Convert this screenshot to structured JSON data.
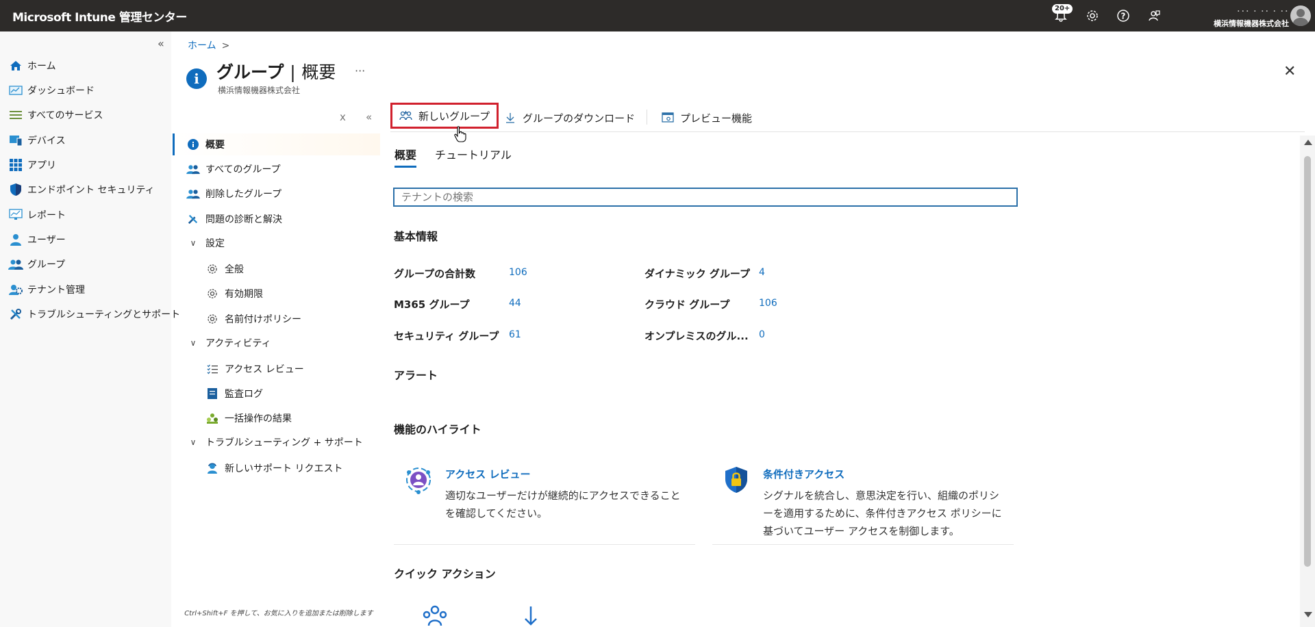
{
  "topbar": {
    "title": "Microsoft Intune 管理センター",
    "notifications_badge": "20+",
    "tenant_top": "･･･ ･ ･･ ･ ･･",
    "tenant_name": "横浜情報機器株式会社"
  },
  "leftnav": {
    "collapse": "«",
    "items": [
      {
        "label": "ホーム",
        "icon": "home-icon"
      },
      {
        "label": "ダッシュボード",
        "icon": "dashboard-icon"
      },
      {
        "label": "すべてのサービス",
        "icon": "list-icon"
      },
      {
        "label": "デバイス",
        "icon": "devices-icon"
      },
      {
        "label": "アプリ",
        "icon": "apps-icon"
      },
      {
        "label": "エンドポイント セキュリティ",
        "icon": "shield-icon"
      },
      {
        "label": "レポート",
        "icon": "report-icon"
      },
      {
        "label": "ユーザー",
        "icon": "user-icon"
      },
      {
        "label": "グループ",
        "icon": "group-icon"
      },
      {
        "label": "テナント管理",
        "icon": "tenant-icon"
      },
      {
        "label": "トラブルシューティングとサポート",
        "icon": "tools-icon"
      }
    ]
  },
  "breadcrumb": {
    "home": "ホーム",
    "sep": ">"
  },
  "page": {
    "title": "グループ",
    "title_sep": "|",
    "title_section": "概要",
    "subtitle": "横浜情報機器株式会社",
    "more": "···",
    "close": "✕"
  },
  "subnav": {
    "close": "x",
    "collapse": "«",
    "items": {
      "overview": "概要",
      "all_groups": "すべてのグループ",
      "deleted_groups": "削除したグループ",
      "diagnose": "問題の診断と解決",
      "settings": "設定",
      "general": "全般",
      "expiration": "有効期限",
      "naming_policy": "名前付けポリシー",
      "activity": "アクティビティ",
      "access_reviews": "アクセス レビュー",
      "audit_logs": "監査ログ",
      "bulk_results": "一括操作の結果",
      "troubleshooting": "トラブルシューティング + サポート",
      "new_support_request": "新しいサポート リクエスト"
    },
    "hint": "Ctrl+Shift+F を押して、お気に入りを追加または削除します"
  },
  "cmdbar": {
    "new_group": "新しいグループ",
    "download_groups": "グループのダウンロード",
    "preview_features": "プレビュー機能"
  },
  "tabs": {
    "overview": "概要",
    "tutorial": "チュートリアル"
  },
  "search": {
    "placeholder": "テナントの検索"
  },
  "basic": {
    "heading": "基本情報",
    "total_label": "グループの合計数",
    "total_value": "106",
    "m365_label": "M365 グループ",
    "m365_value": "44",
    "security_label": "セキュリティ グループ",
    "security_value": "61",
    "dynamic_label": "ダイナミック グループ",
    "dynamic_value": "4",
    "cloud_label": "クラウド グループ",
    "cloud_value": "106",
    "onprem_label": "オンプレミスのグル...",
    "onprem_value": "0"
  },
  "alerts": {
    "heading": "アラート"
  },
  "highlights": {
    "heading": "機能のハイライト",
    "access_review_title": "アクセス レビュー",
    "access_review_line1": "適切なユーザーだけが継続的にアクセスできること",
    "access_review_line2": "を確認してください。",
    "conditional_title": "条件付きアクセス",
    "conditional_line1": "シグナルを統合し、意思決定を行い、組織のポリシ",
    "conditional_line2": "ーを適用するために、条件付きアクセス ポリシーに",
    "conditional_line3": "基づいてユーザー アクセスを制御します。"
  },
  "quick_actions": {
    "heading": "クイック アクション"
  },
  "colors": {
    "accent": "#0f6cbd",
    "topbar": "#2d2b29",
    "highlight_border": "#d1202d"
  }
}
